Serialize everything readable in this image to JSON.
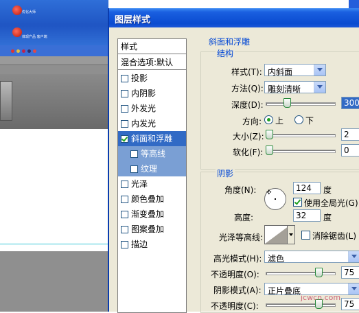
{
  "dialog": {
    "title": "图层样式"
  },
  "background": {
    "desktop_icons": [
      "优化大师",
      "体现产品\n客户端"
    ]
  },
  "style_list": {
    "header": "样式",
    "blend_options": "混合选项:默认",
    "effects": [
      {
        "label": "投影",
        "checked": false,
        "sub": false,
        "state": "normal"
      },
      {
        "label": "内阴影",
        "checked": false,
        "sub": false,
        "state": "normal"
      },
      {
        "label": "外发光",
        "checked": false,
        "sub": false,
        "state": "normal"
      },
      {
        "label": "内发光",
        "checked": false,
        "sub": false,
        "state": "normal"
      },
      {
        "label": "斜面和浮雕",
        "checked": true,
        "sub": false,
        "state": "selected"
      },
      {
        "label": "等高线",
        "checked": false,
        "sub": true,
        "state": "sub"
      },
      {
        "label": "纹理",
        "checked": false,
        "sub": true,
        "state": "sub"
      },
      {
        "label": "光泽",
        "checked": false,
        "sub": false,
        "state": "normal"
      },
      {
        "label": "颜色叠加",
        "checked": false,
        "sub": false,
        "state": "normal"
      },
      {
        "label": "渐变叠加",
        "checked": false,
        "sub": false,
        "state": "normal"
      },
      {
        "label": "图案叠加",
        "checked": false,
        "sub": false,
        "state": "normal"
      },
      {
        "label": "描边",
        "checked": false,
        "sub": false,
        "state": "normal"
      }
    ]
  },
  "bevel": {
    "section_title": "斜面和浮雕",
    "structure": {
      "title": "结构",
      "style_label": "样式(T):",
      "style_value": "内斜面",
      "method_label": "方法(Q):",
      "method_value": "雕刻清晰",
      "depth_label": "深度(D):",
      "depth_value": "300",
      "depth_fraction": 0.3,
      "direction_label": "方向:",
      "dir_up": "上",
      "dir_down": "下",
      "size_label": "大小(Z):",
      "size_value": "2",
      "soften_label": "软化(F):",
      "soften_value": "0"
    },
    "shading": {
      "title": "阴影",
      "angle_label": "角度(N):",
      "angle_value": "124",
      "degree": "度",
      "global_light": "使用全局光(G)",
      "altitude_label": "高度:",
      "altitude_value": "32",
      "gloss_label": "光泽等高线:",
      "anti_alias": "消除锯齿(L)",
      "highlight_label": "高光模式(H):",
      "highlight_value": "滤色",
      "opacity_label": "不透明度(O):",
      "opacity_value": "75",
      "shadow_label": "阴影模式(A):",
      "shadow_value": "正片叠底",
      "opacity2_label": "不透明度(C):",
      "opacity2_value": "75"
    }
  },
  "watermark": "jcwcn.com",
  "colors": {
    "title_bar": "#1a5fe0",
    "selection": "#316ac5",
    "section_title": "#0046d5",
    "dialog_bg": "#ece9d8"
  }
}
